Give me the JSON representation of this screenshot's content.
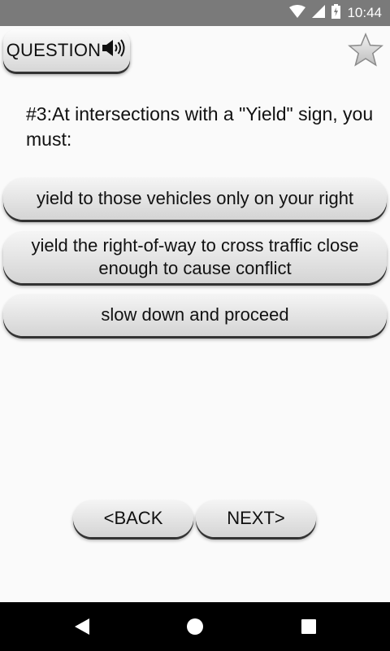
{
  "status_bar": {
    "time": "10:44"
  },
  "header": {
    "question_label": "QUESTION"
  },
  "question": {
    "text": "#3:At intersections with a \"Yield\" sign, you must:"
  },
  "answers": [
    {
      "text": "yield to those vehicles only on your right"
    },
    {
      "text": "yield the right-of-way to cross traffic close enough to cause conflict"
    },
    {
      "text": "slow down and proceed"
    }
  ],
  "navigation": {
    "back_label": "<BACK",
    "next_label": "NEXT>"
  },
  "icons": {
    "speaker": "speaker-icon",
    "favorite": "star-icon",
    "wifi": "wifi-icon",
    "signal": "signal-icon",
    "battery": "battery-icon",
    "back": "back-triangle-icon",
    "home": "home-circle-icon",
    "recents": "recents-square-icon"
  },
  "colors": {
    "status_bar": "#7a7a7a",
    "background": "#fafafa",
    "button_top": "#f5f5f5",
    "button_bottom": "#d4d4d4",
    "system_nav": "#000000"
  }
}
